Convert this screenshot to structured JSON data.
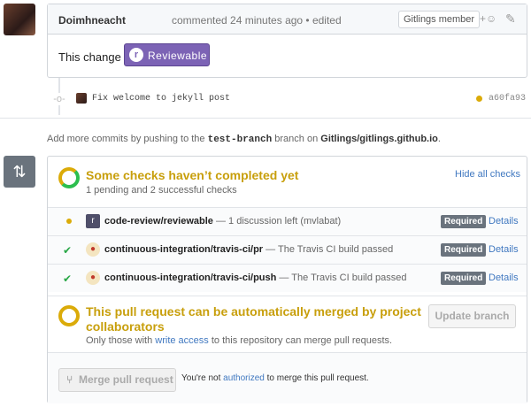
{
  "comment": {
    "author": "Doimhneacht",
    "meta": "commented 24 minutes ago • edited",
    "badge": "Gitlings member",
    "react_glyph": "+☺",
    "edit_glyph": "✎",
    "body_text": "This change is",
    "reviewable_label": "Reviewable"
  },
  "commit": {
    "message": "Fix welcome to jekyll post",
    "sha": "a60fa93",
    "status_color": "#dbab09"
  },
  "add_commits": {
    "prefix": "Add more commits by pushing to the",
    "branch": "test-branch",
    "mid": "branch on",
    "repo": "Gitlings/gitlings.github.io",
    "suffix": "."
  },
  "checks": {
    "title": "Some checks haven’t completed yet",
    "subtitle": "1 pending and 2 successful checks",
    "hide_label": "Hide all checks",
    "items": [
      {
        "state": "pending",
        "name": "code-review/reviewable",
        "desc": "— 1 discussion left (mvlabat)",
        "required": "Required",
        "details": "Details",
        "app_icon": "reviewable-icon"
      },
      {
        "state": "success",
        "name": "continuous-integration/travis-ci/pr",
        "desc": "— The Travis CI build passed",
        "required": "Required",
        "details": "Details",
        "app_icon": "travis-icon"
      },
      {
        "state": "success",
        "name": "continuous-integration/travis-ci/push",
        "desc": "— The Travis CI build passed",
        "required": "Required",
        "details": "Details",
        "app_icon": "travis-icon"
      }
    ]
  },
  "merge": {
    "title": "This pull request can be automatically merged by project collaborators",
    "note_prefix": "Only those with",
    "note_link": "write access",
    "note_suffix": "to this repository can merge pull requests.",
    "update_label": "Update branch",
    "merge_label": "Merge pull request",
    "not_auth_prefix": "You're not",
    "not_auth_link": "authorized",
    "not_auth_suffix": "to merge this pull request."
  },
  "colors": {
    "pending": "#dbab09",
    "success": "#28a745",
    "link": "#4078c0",
    "reviewable": "#7c63b5"
  }
}
